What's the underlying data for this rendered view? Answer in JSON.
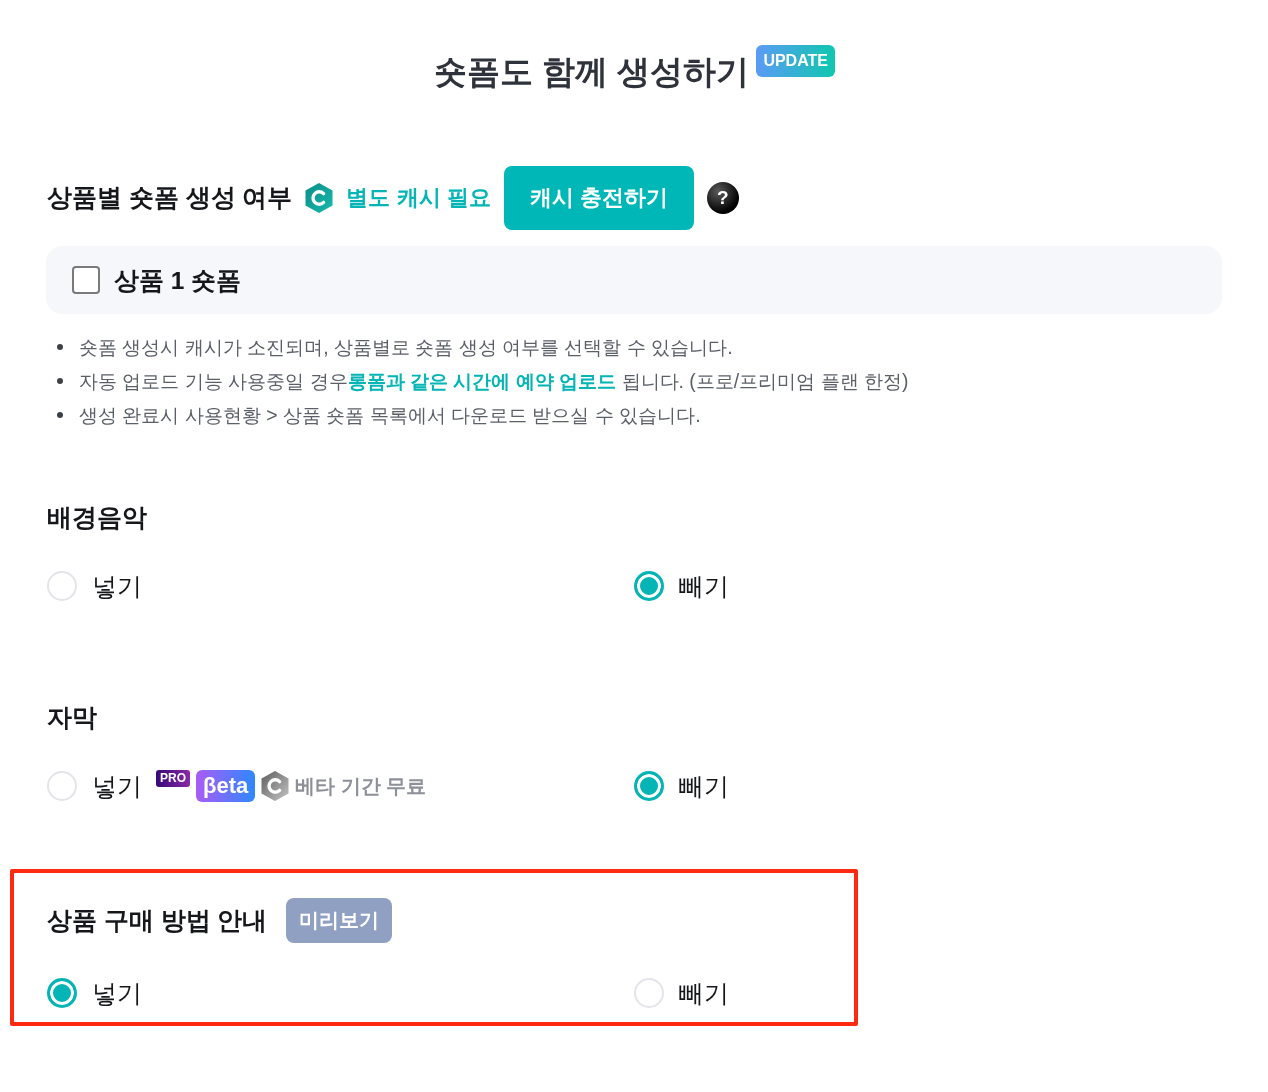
{
  "title": {
    "text": "숏폼도 함께 생성하기",
    "badge": "UPDATE"
  },
  "shortform": {
    "heading": "상품별 숏폼 생성 여부",
    "cash_note": "별도 캐시 필요",
    "charge_button": "캐시 충전하기",
    "help": "?",
    "products": [
      {
        "label": "상품 1 숏폼",
        "checked": false
      }
    ],
    "notes": [
      "숏폼 생성시 캐시가 소진되며, 상품별로 숏폼 생성 여부를 선택할 수 있습니다.",
      "자동 업로드 기능 사용중일 경우**롱폼과 같은 시간에 예약 업로드** 됩니다. (프로/프리미엄 플랜 한정)",
      "생성 완료시 사용현황 > 상품 숏폼 목록에서 다운로드 받으실 수 있습니다."
    ]
  },
  "sections": [
    {
      "heading": "배경음악",
      "highlighted": false,
      "options": [
        {
          "label": "넣기",
          "selected": false
        },
        {
          "label": "빼기",
          "selected": true
        }
      ]
    },
    {
      "heading": "자막",
      "highlighted": false,
      "options": [
        {
          "label": "넣기",
          "selected": false,
          "badges": [
            {
              "kind": "pro",
              "text": "PRO"
            },
            {
              "kind": "beta",
              "text": "βeta"
            }
          ],
          "note": "베타 기간 무료"
        },
        {
          "label": "빼기",
          "selected": true
        }
      ]
    },
    {
      "heading": "상품 구매 방법 안내",
      "preview_button": "미리보기",
      "highlighted": true,
      "options": [
        {
          "label": "넣기",
          "selected": true
        },
        {
          "label": "빼기",
          "selected": false
        }
      ]
    }
  ]
}
